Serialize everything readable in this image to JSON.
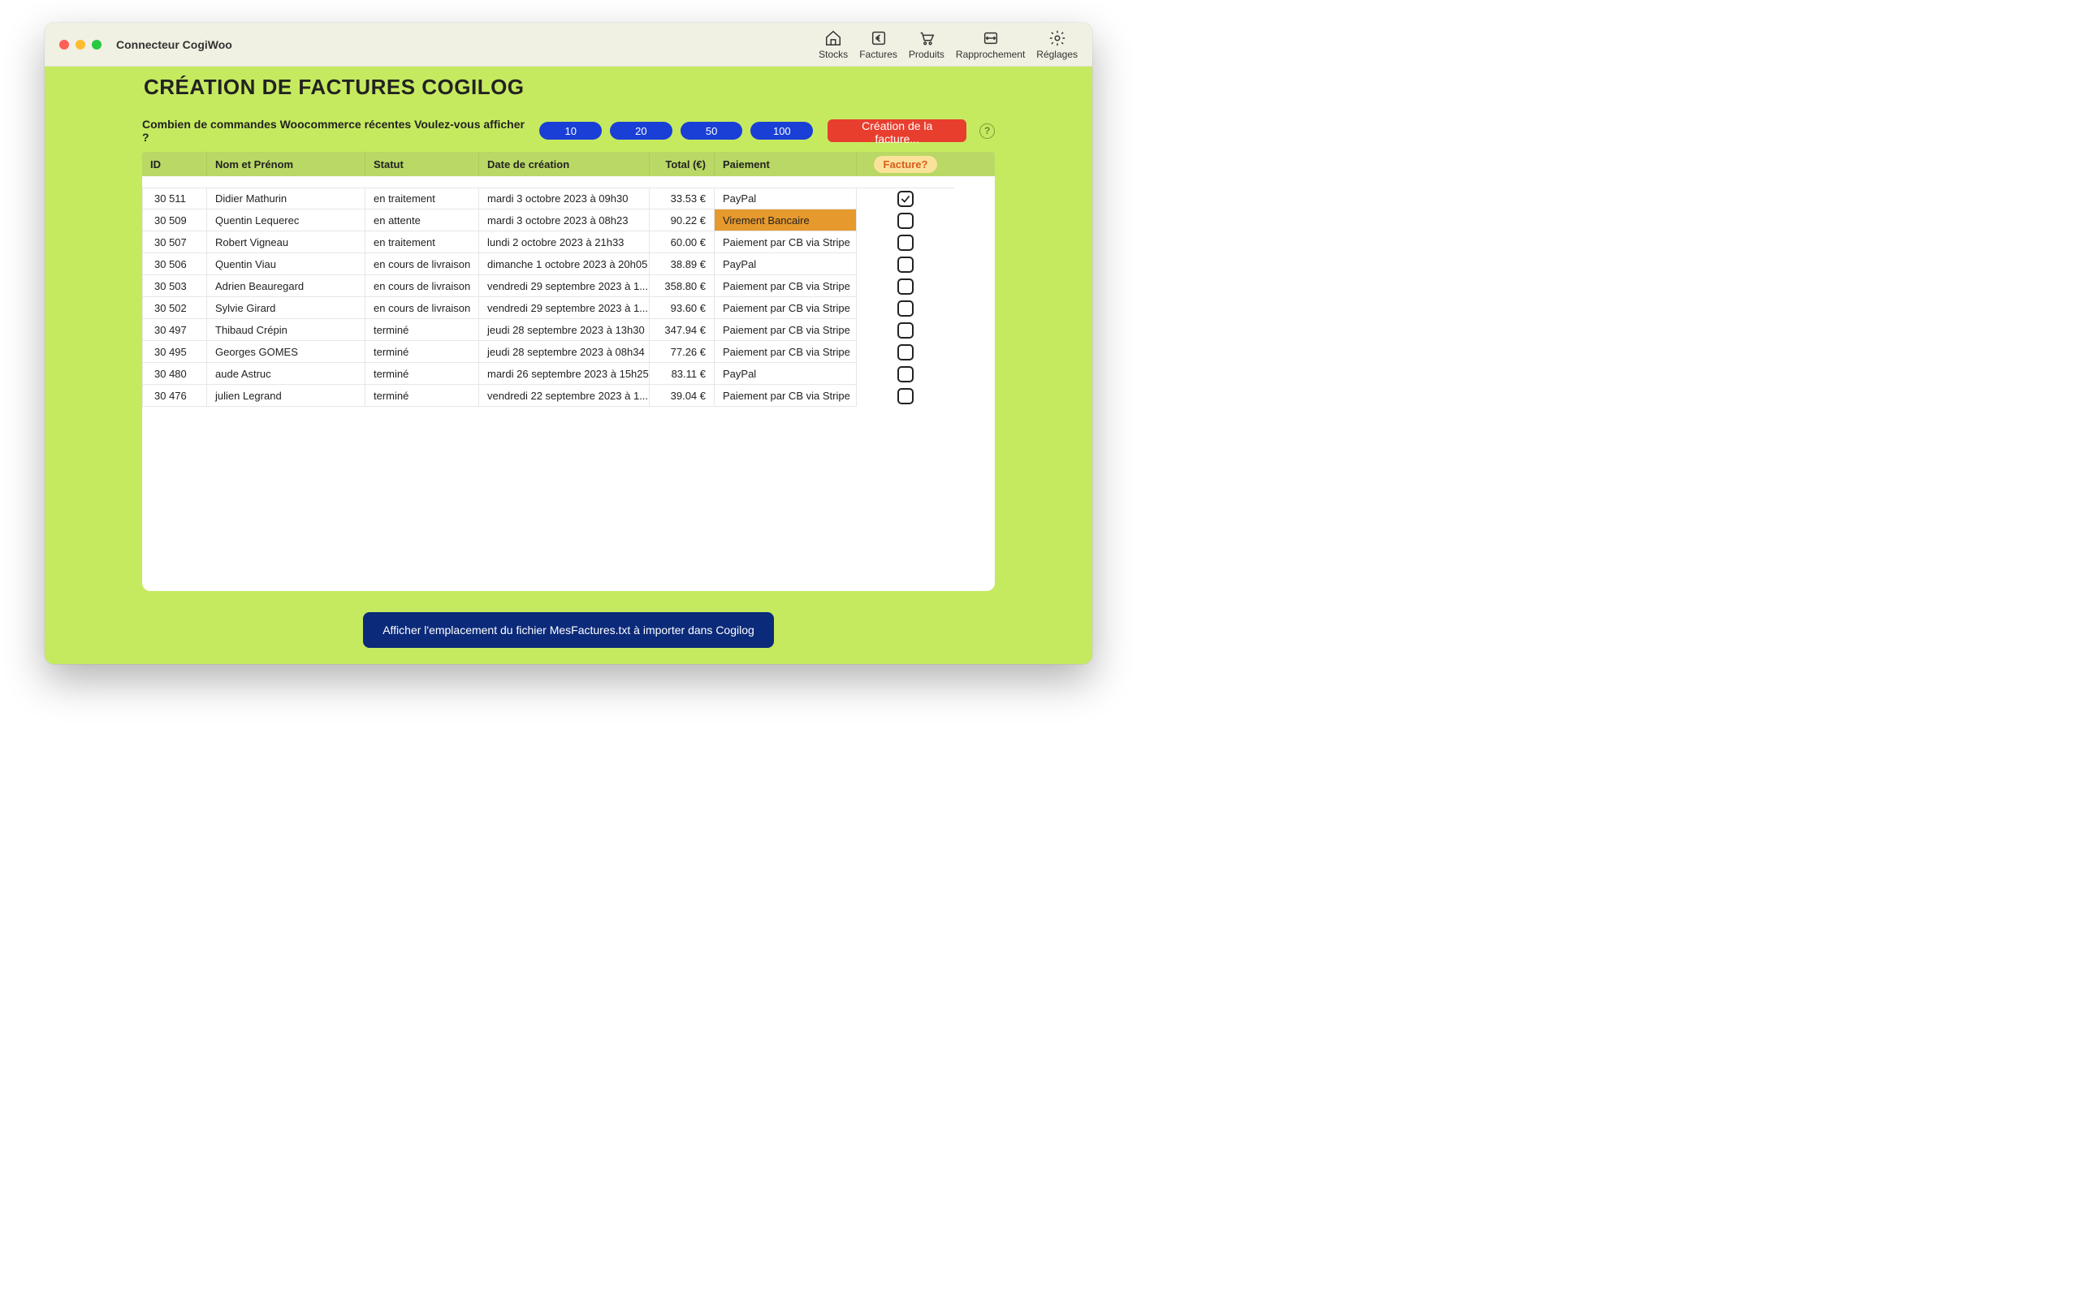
{
  "titlebar": {
    "app_title": "Connecteur CogiWoo"
  },
  "nav": {
    "stocks": "Stocks",
    "factures": "Factures",
    "produits": "Produits",
    "rapprochement": "Rapprochement",
    "reglages": "Réglages"
  },
  "page": {
    "title": "CRÉATION DE FACTURES COGILOG",
    "toolbar_label": "Combien de commandes Woocommerce récentes Voulez-vous afficher ?",
    "counts": {
      "a": "10",
      "b": "20",
      "c": "50",
      "d": "100"
    },
    "create_button": "Création de la facture...",
    "help": "?"
  },
  "columns": {
    "id": "ID",
    "nom": "Nom et Prénom",
    "statut": "Statut",
    "date": "Date de création",
    "total": "Total (€)",
    "paiement": "Paiement",
    "facture": "Facture?"
  },
  "rows": [
    {
      "id": "30 511",
      "nom": "Didier  Mathurin",
      "statut": "en traitement",
      "date": "mardi 3 octobre 2023 à 09h30",
      "total": "33.53 €",
      "paiement": "PayPal",
      "highlight": false,
      "checked": true
    },
    {
      "id": "30 509",
      "nom": "Quentin  Lequerec",
      "statut": "en attente",
      "date": "mardi 3 octobre 2023 à 08h23",
      "total": "90.22 €",
      "paiement": "Virement Bancaire",
      "highlight": true,
      "checked": false
    },
    {
      "id": "30 507",
      "nom": "Robert Vigneau",
      "statut": "en traitement",
      "date": "lundi 2 octobre 2023 à 21h33",
      "total": "60.00 €",
      "paiement": "Paiement par CB via Stripe",
      "highlight": false,
      "checked": false
    },
    {
      "id": "30 506",
      "nom": "Quentin  Viau",
      "statut": "en cours de livraison",
      "date": "dimanche 1 octobre 2023 à 20h05",
      "total": "38.89 €",
      "paiement": "PayPal",
      "highlight": false,
      "checked": false
    },
    {
      "id": "30 503",
      "nom": "Adrien Beauregard",
      "statut": "en cours de livraison",
      "date": "vendredi 29 septembre 2023 à 1...",
      "total": "358.80 €",
      "paiement": "Paiement par CB via Stripe",
      "highlight": false,
      "checked": false
    },
    {
      "id": "30 502",
      "nom": "Sylvie Girard",
      "statut": "en cours de livraison",
      "date": "vendredi 29 septembre 2023 à 1...",
      "total": "93.60 €",
      "paiement": "Paiement par CB via Stripe",
      "highlight": false,
      "checked": false
    },
    {
      "id": "30 497",
      "nom": "Thibaud Crépin",
      "statut": "terminé",
      "date": "jeudi 28 septembre 2023 à 13h30",
      "total": "347.94 €",
      "paiement": "Paiement par CB via Stripe",
      "highlight": false,
      "checked": false
    },
    {
      "id": "30 495",
      "nom": "Georges GOMES",
      "statut": "terminé",
      "date": "jeudi 28 septembre 2023 à 08h34",
      "total": "77.26 €",
      "paiement": "Paiement par CB via Stripe",
      "highlight": false,
      "checked": false
    },
    {
      "id": "30 480",
      "nom": "aude Astruc",
      "statut": "terminé",
      "date": "mardi 26 septembre 2023 à 15h25",
      "total": "83.11 €",
      "paiement": "PayPal",
      "highlight": false,
      "checked": false
    },
    {
      "id": "30 476",
      "nom": "julien Legrand",
      "statut": "terminé",
      "date": "vendredi 22 septembre 2023 à 1...",
      "total": "39.04 €",
      "paiement": "Paiement par CB via Stripe",
      "highlight": false,
      "checked": false
    }
  ],
  "footer": {
    "button": "Afficher l'emplacement du fichier MesFactures.txt à importer dans Cogilog"
  }
}
